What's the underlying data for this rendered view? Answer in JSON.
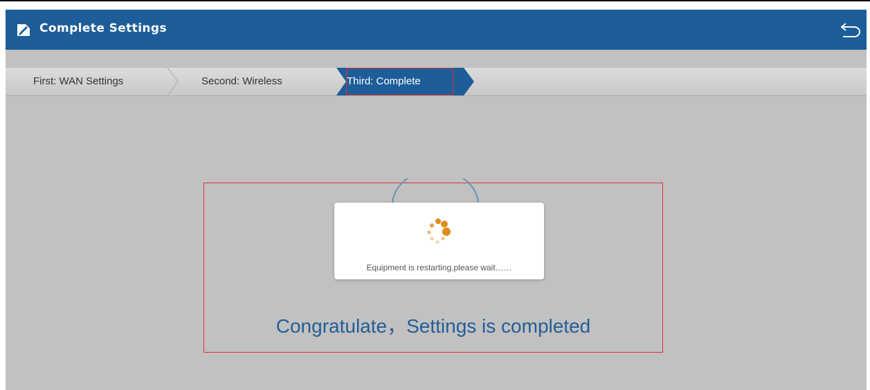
{
  "header": {
    "title": "Complete Settings",
    "icon": "settings-note-icon",
    "back_icon": "back-arrow-icon",
    "bg_color": "#1d5d99"
  },
  "steps": [
    {
      "label": "First: WAN Settings",
      "active": false
    },
    {
      "label": "Second: Wireless",
      "active": false
    },
    {
      "label": "Third: Complete",
      "active": true
    }
  ],
  "dialog": {
    "message": "Equipment is restarting,please wait……",
    "spinner_color": "#e08a1e"
  },
  "main": {
    "message": "Congratulate，Settings is completed"
  }
}
